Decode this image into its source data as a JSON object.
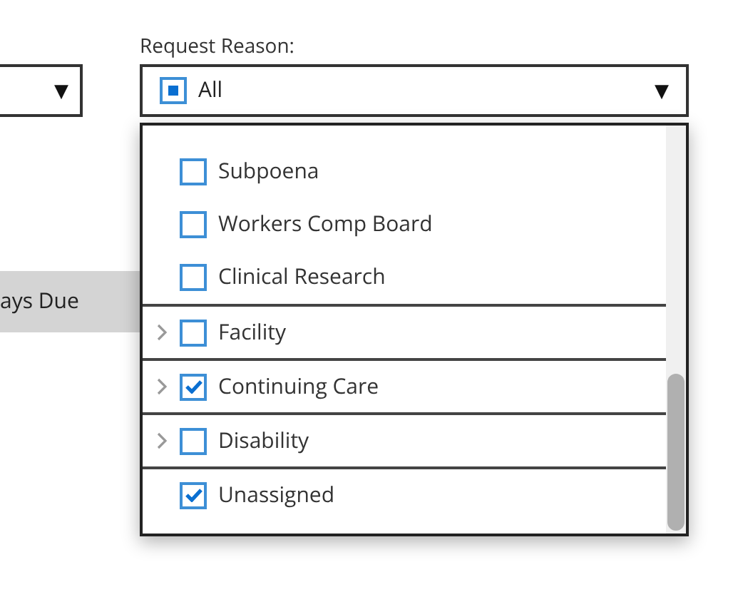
{
  "left_select": {
    "arrow": "▼"
  },
  "days_due_header": "ays Due",
  "request_reason": {
    "label": "Request Reason:",
    "value": "All",
    "partial": true,
    "arrow": "▼",
    "items": [
      {
        "label": "Subpoena",
        "kind": "plain",
        "checked": false
      },
      {
        "label": "Workers Comp Board",
        "kind": "plain",
        "checked": false
      },
      {
        "label": "Clinical Research",
        "kind": "plain",
        "checked": false
      },
      {
        "label": "Facility",
        "kind": "group",
        "checked": false
      },
      {
        "label": "Continuing Care",
        "kind": "group",
        "checked": true
      },
      {
        "label": "Disability",
        "kind": "group",
        "checked": false
      },
      {
        "label": "Unassigned",
        "kind": "single",
        "checked": true
      }
    ]
  }
}
